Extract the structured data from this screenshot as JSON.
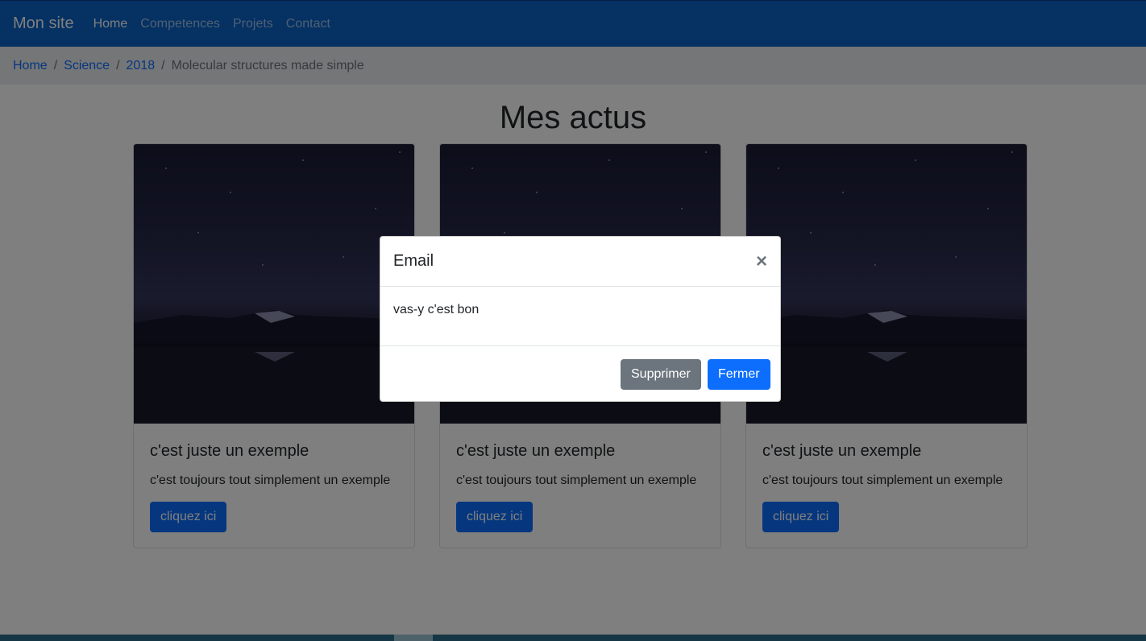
{
  "navbar": {
    "brand": "Mon site",
    "items": [
      {
        "label": "Home"
      },
      {
        "label": "Competences"
      },
      {
        "label": "Projets"
      },
      {
        "label": "Contact"
      }
    ]
  },
  "breadcrumb": {
    "links": [
      "Home",
      "Science",
      "2018"
    ],
    "separator": "/",
    "current": "Molecular structures made simple"
  },
  "page": {
    "title": "Mes actus"
  },
  "cards": [
    {
      "title": "c'est juste un exemple",
      "text": "c'est toujours tout simplement un exemple",
      "button": "cliquez ici"
    },
    {
      "title": "c'est juste un exemple",
      "text": "c'est toujours tout simplement un exemple",
      "button": "cliquez ici"
    },
    {
      "title": "c'est juste un exemple",
      "text": "c'est toujours tout simplement un exemple",
      "button": "cliquez ici"
    }
  ],
  "modal": {
    "title": "Email",
    "close_symbol": "×",
    "body": "vas-y c'est bon",
    "secondary_button": "Supprimer",
    "primary_button": "Fermer"
  },
  "colors": {
    "navbar": "#0b62c7",
    "primary": "#0d6efd",
    "secondary": "#6c757d",
    "breadcrumb_bg": "#e9ecef"
  },
  "icons": {
    "close": "close-icon",
    "card_image": "night-mountain-lake-image"
  }
}
